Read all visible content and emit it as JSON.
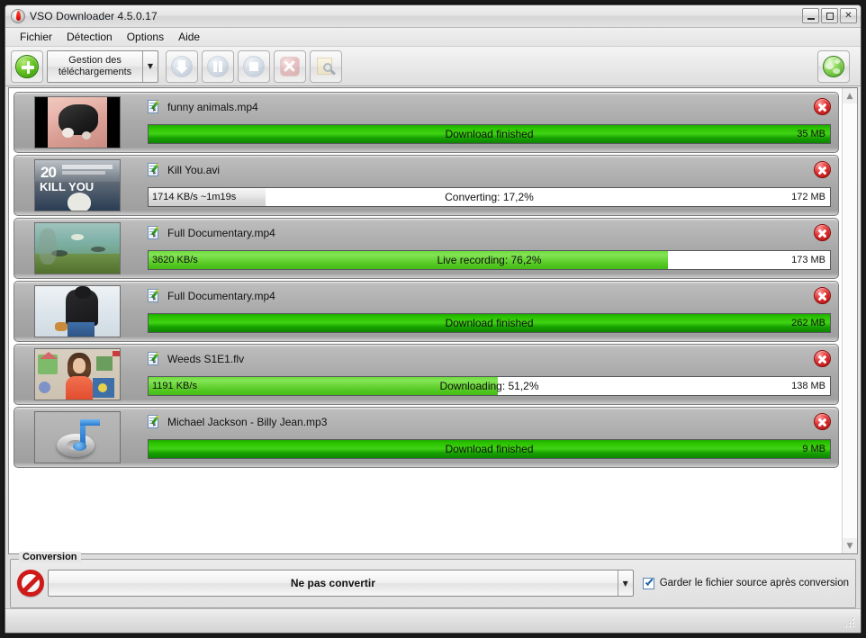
{
  "window": {
    "title": "VSO Downloader 4.5.0.17",
    "icon": "vso-flame-icon",
    "controls": {
      "minimize": "–",
      "maximize": "□",
      "close": "✕"
    }
  },
  "menubar": {
    "items": [
      "Fichier",
      "Détection",
      "Options",
      "Aide"
    ]
  },
  "toolbar": {
    "add_button": "add-download-button",
    "mode_combo": {
      "label": "Gestion des téléchargements",
      "arrow": "▼"
    },
    "buttons": [
      {
        "name": "download-button",
        "icon": "download-arrow-icon",
        "enabled": false
      },
      {
        "name": "pause-button",
        "icon": "pause-icon",
        "enabled": false
      },
      {
        "name": "stop-button",
        "icon": "stop-icon",
        "enabled": false
      },
      {
        "name": "cancel-button",
        "icon": "cancel-x-icon",
        "enabled": false
      },
      {
        "name": "inspect-button",
        "icon": "page-search-icon",
        "enabled": false
      }
    ],
    "browser_button": {
      "name": "open-browser-button",
      "icon": "globe-icon"
    }
  },
  "downloads": [
    {
      "filename": "funny animals.mp4",
      "thumbnail": "puppy-dog-photo",
      "status_text": "Download finished",
      "size": "35 MB",
      "speed": "",
      "percent": 100,
      "fill_style": "green-dark",
      "state": "finished"
    },
    {
      "filename": "Kill You.avi",
      "thumbnail": "kill-you-video-cover",
      "status_text": "Converting: 17,2%",
      "size": "172 MB",
      "speed": "1714 KB/s  ~1m19s",
      "percent": 17.2,
      "fill_style": "grey",
      "state": "converting"
    },
    {
      "filename": "Full Documentary.mp4",
      "thumbnail": "underwater-fish-scene",
      "status_text": "Live recording: 76,2%",
      "size": "173 MB",
      "speed": "3620 KB/s",
      "percent": 76.2,
      "fill_style": "green-light",
      "state": "recording"
    },
    {
      "filename": "Full Documentary.mp4",
      "thumbnail": "person-snow-photo",
      "status_text": "Download finished",
      "size": "262 MB",
      "speed": "",
      "percent": 100,
      "fill_style": "green-dark",
      "state": "finished"
    },
    {
      "filename": "Weeds S1E1.flv",
      "thumbnail": "weeds-tv-show-scene",
      "status_text": "Downloading: 51,2%",
      "size": "138 MB",
      "speed": "1191 KB/s",
      "percent": 51.2,
      "fill_style": "green-light",
      "state": "downloading"
    },
    {
      "filename": "Michael Jackson - Billy Jean.mp3",
      "thumbnail": "audio-note-icon",
      "status_text": "Download finished",
      "size": "9 MB",
      "speed": "",
      "percent": 100,
      "fill_style": "green-dark",
      "state": "finished"
    }
  ],
  "scrollbar": {
    "up": "▲",
    "down": "▼"
  },
  "conversion": {
    "legend": "Conversion",
    "icon": "no-convert-icon",
    "selected": "Ne pas convertir",
    "arrow": "▼",
    "keep_source_label": "Garder le fichier source après conversion",
    "keep_source_checked": true
  },
  "colors": {
    "green_finished": "#2cc400",
    "green_active": "#64d232",
    "red_close": "#e23232",
    "window_chrome": "#e4e4e4",
    "row_bg": "#a9a9a9"
  }
}
